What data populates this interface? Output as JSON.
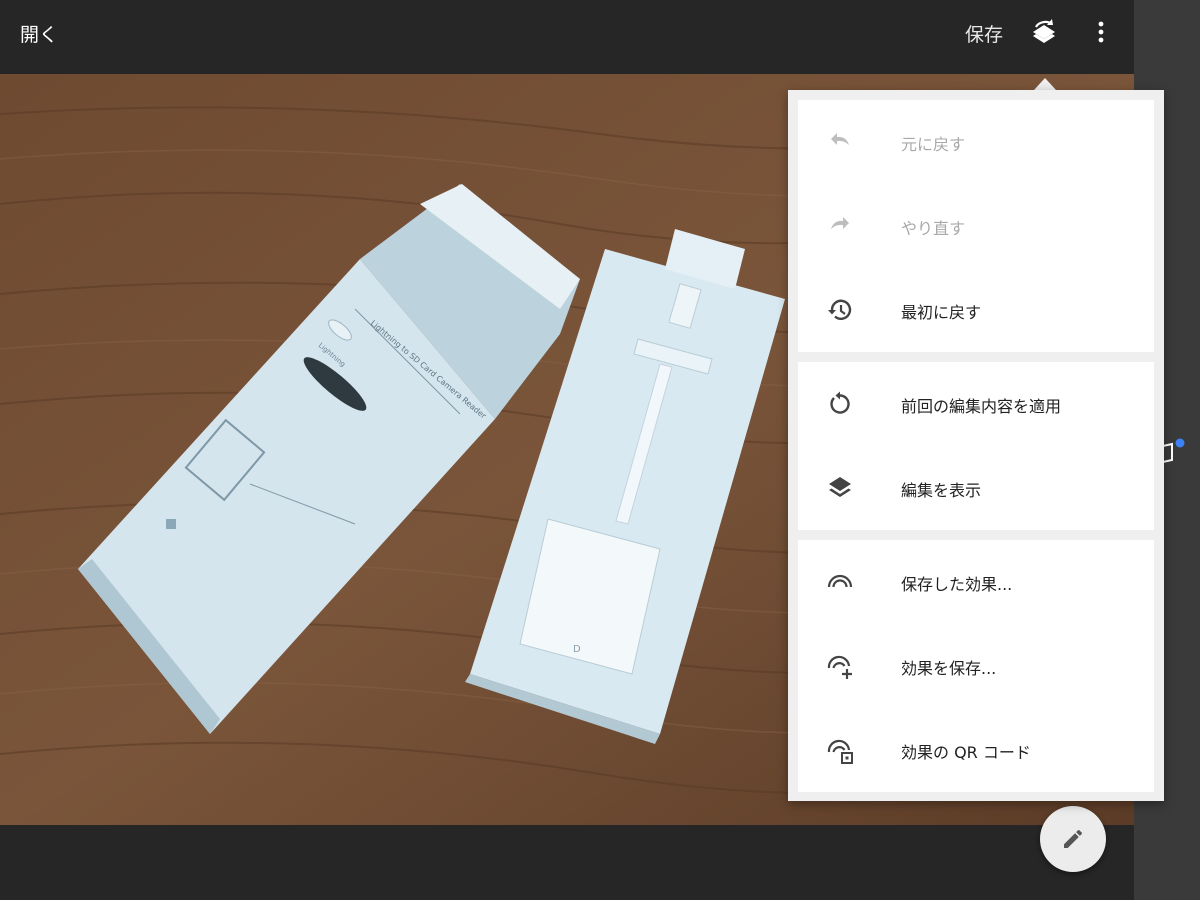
{
  "toolbar": {
    "open_label": "開く",
    "save_label": "保存"
  },
  "menu": {
    "undo": "元に戻す",
    "redo": "やり直す",
    "revert": "最初に戻す",
    "apply_last_edits": "前回の編集内容を適用",
    "view_edits": "編集を表示",
    "saved_looks": "保存した効果...",
    "save_look": "効果を保存...",
    "look_qr": "効果の QR コード"
  },
  "photo": {
    "box_text_1": "Lightning to SD Card Camera Reader",
    "box_text_2": "Lightning",
    "adapter_mark": "D"
  },
  "icons": {
    "undo": "undo-icon",
    "redo": "redo-icon",
    "revert": "history-icon",
    "apply": "replay-icon",
    "view": "layers-icon",
    "saved_looks": "rainbow-icon",
    "save_look": "rainbow-add-icon",
    "qr": "rainbow-qr-icon",
    "fab": "pencil-icon"
  },
  "colors": {
    "bar": "#262626",
    "menu_bg": "#efefef",
    "disabled_text": "#a9a9a9",
    "notification_dot": "#3b82f6"
  }
}
